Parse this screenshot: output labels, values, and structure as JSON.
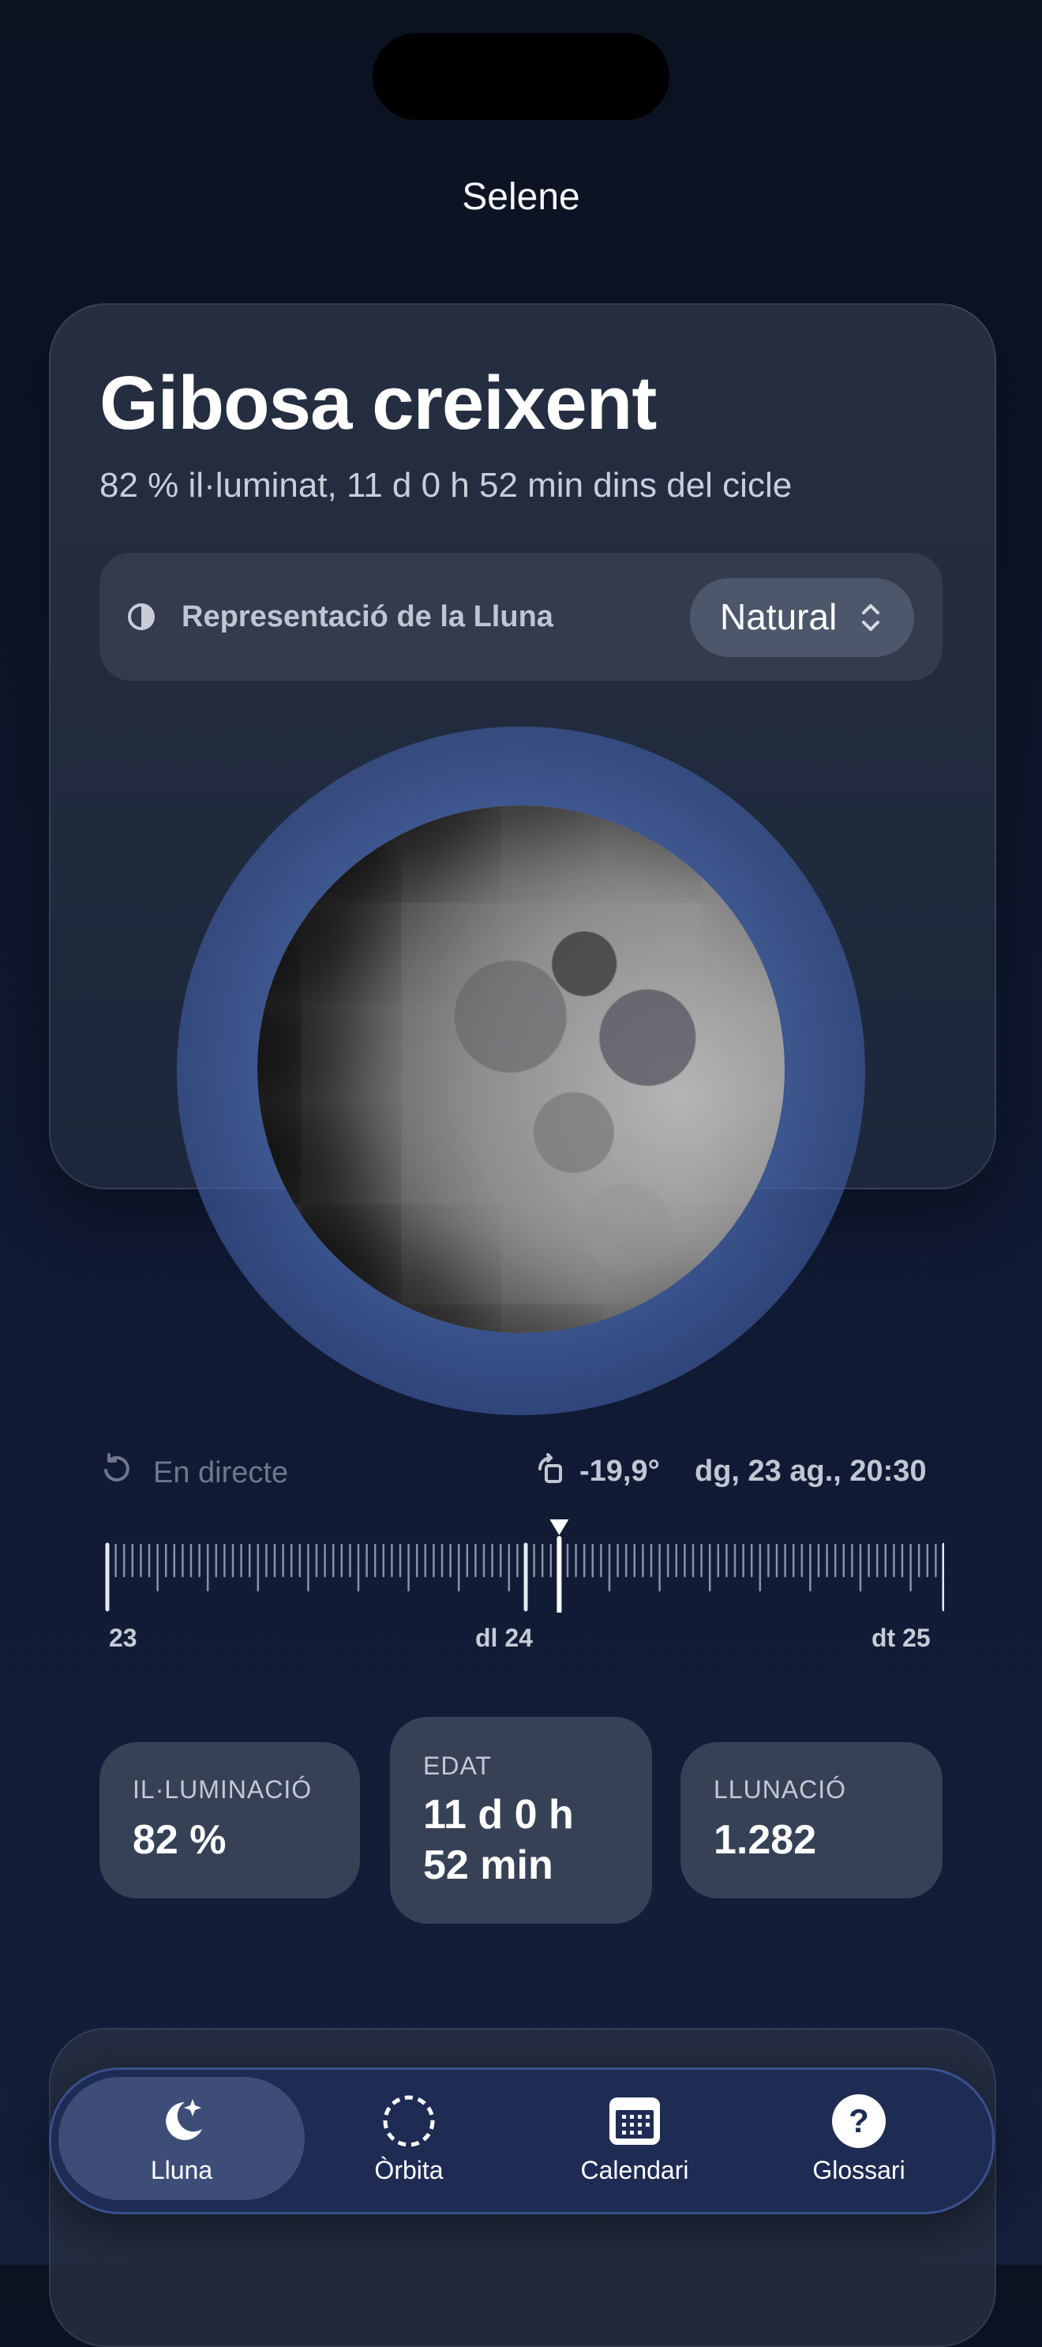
{
  "app": {
    "title": "Selene"
  },
  "phase": {
    "name": "Gibosa creixent",
    "summary": "82 % il·luminat, 11 d 0 h 52 min dins del cicle"
  },
  "representation": {
    "label": "Representació de la Lluna",
    "value": "Natural",
    "icon": "half-circle-icon"
  },
  "timeline": {
    "live_label": "En directe",
    "rotation": "-19,9°",
    "datetime": "dg, 23 ag., 20:30",
    "labels": [
      "23",
      "dl 24",
      "dt 25"
    ]
  },
  "stats": {
    "illumination": {
      "label": "IL·LUMINACIÓ",
      "value": "82 %"
    },
    "age": {
      "label": "EDAT",
      "value_line1": "11 d 0 h",
      "value_line2": "52 min"
    },
    "lunation": {
      "label": "LLUNACIÓ",
      "value": "1.282"
    }
  },
  "tabs": [
    {
      "label": "Lluna",
      "icon": "moon-stars-icon",
      "active": true
    },
    {
      "label": "Òrbita",
      "icon": "orbit-icon",
      "active": false
    },
    {
      "label": "Calendari",
      "icon": "calendar-icon",
      "active": false
    },
    {
      "label": "Glossari",
      "icon": "question-icon",
      "active": false
    }
  ],
  "colors": {
    "background": "#0f1830",
    "card": "#283042",
    "halo": "#5a78c0",
    "tabbar_border": "#5070be"
  }
}
